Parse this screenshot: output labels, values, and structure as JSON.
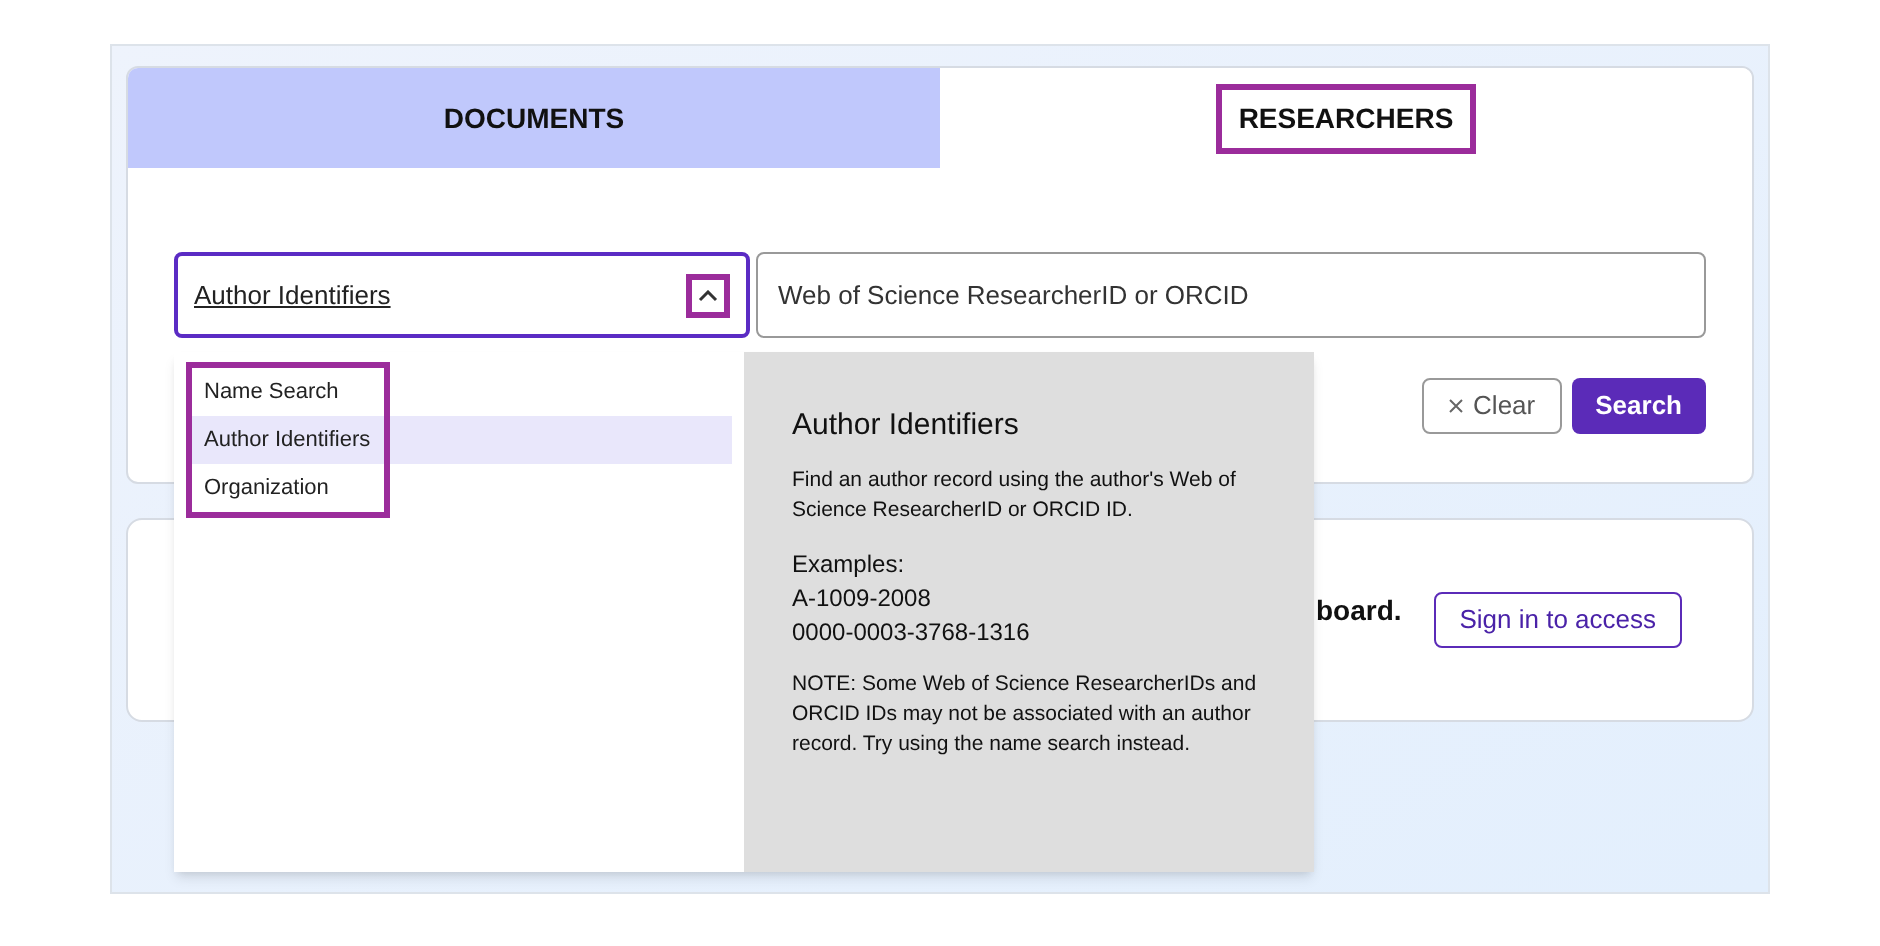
{
  "tabs": [
    {
      "label": "DOCUMENTS",
      "selected": false
    },
    {
      "label": "RESEARCHERS",
      "selected": true
    }
  ],
  "search_type": {
    "value": "Author Identifiers",
    "expanded": true
  },
  "search_field": {
    "placeholder": "Web of Science ResearcherID or ORCID"
  },
  "buttons": {
    "clear": "Clear",
    "search": "Search"
  },
  "menu": [
    {
      "label": "Name Search",
      "selected": false
    },
    {
      "label": "Author Identifiers",
      "selected": true
    },
    {
      "label": "Organization",
      "selected": false
    }
  ],
  "help": {
    "title": "Author Identifiers",
    "description": "Find an author record using the author's Web of Science ResearcherID or ORCID ID.",
    "examples_label": "Examples:",
    "examples": [
      "A-1009-2008",
      "0000-0003-3768-1316"
    ],
    "note": "NOTE: Some Web of Science ResearcherIDs and ORCID IDs may not be associated with an author record. Try using the name search instead."
  },
  "banner": {
    "text": "board.",
    "button": "Sign in to access"
  }
}
